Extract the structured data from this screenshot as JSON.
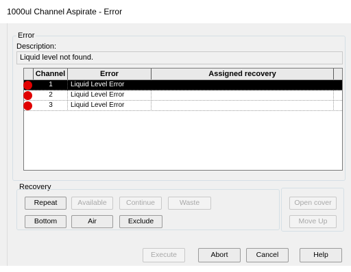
{
  "window": {
    "title": "1000ul Channel Aspirate - Error"
  },
  "error_group": {
    "label": "Error",
    "description_label": "Description:",
    "description": "Liquid level not found."
  },
  "table": {
    "headers": [
      "Channel",
      "Error",
      "Assigned recovery"
    ],
    "rows": [
      {
        "channel": "1",
        "error": "Liquid Level Error",
        "recovery": "",
        "selected": true
      },
      {
        "channel": "2",
        "error": "Liquid Level Error",
        "recovery": "",
        "selected": false
      },
      {
        "channel": "3",
        "error": "Liquid Level Error",
        "recovery": "",
        "selected": false
      }
    ]
  },
  "recovery": {
    "label": "Recovery",
    "buttons": {
      "repeat": "Repeat",
      "available": "Available",
      "continue": "Continue",
      "waste": "Waste",
      "bottom": "Bottom",
      "air": "Air",
      "exclude": "Exclude",
      "open_cover": "Open cover",
      "move_up": "Move Up"
    }
  },
  "footer": {
    "execute": "Execute",
    "abort": "Abort",
    "cancel": "Cancel",
    "help": "Help"
  },
  "colors": {
    "error_dot": "#e00000",
    "selected_row": "#000000"
  }
}
